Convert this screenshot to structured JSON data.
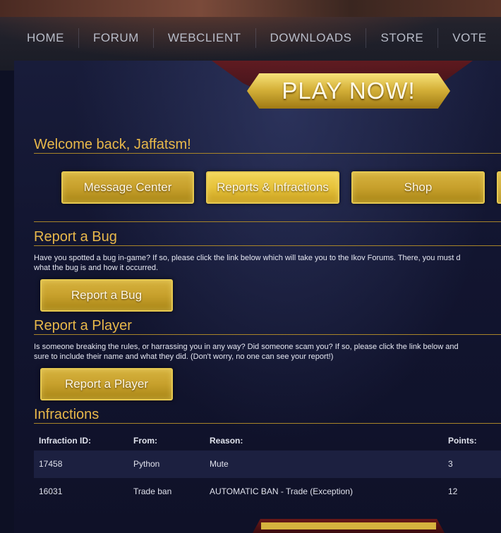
{
  "nav": {
    "items": [
      "HOME",
      "FORUM",
      "WEBCLIENT",
      "DOWNLOADS",
      "STORE",
      "VOTE"
    ]
  },
  "play_button": {
    "label": "PLAY NOW!"
  },
  "welcome": {
    "title": "Welcome back, Jaffatsm!"
  },
  "account_tabs": [
    "Message Center",
    "Reports & Infractions",
    "Shop"
  ],
  "report_bug": {
    "title": "Report a Bug",
    "text_line1": "Have you spotted a bug in-game? If so, please click the link below which will take you to the Ikov Forums. There, you must d",
    "text_line2": "what the bug is and how it occurred.",
    "button": "Report a Bug"
  },
  "report_player": {
    "title": "Report a Player",
    "text_line1": "Is someone breaking the rules, or harrassing you in any way? Did someone scam you? If so, please click the link below and",
    "text_line2": "sure to include their name and what they did. (Don't worry, no one can see your report!)",
    "button": "Report a Player"
  },
  "infractions": {
    "title": "Infractions",
    "headers": [
      "Infraction ID:",
      "From:",
      "Reason:",
      "Points:"
    ],
    "rows": [
      [
        "17458",
        "Python",
        "Mute",
        "3"
      ],
      [
        "16031",
        "Trade ban",
        "AUTOMATIC BAN - Trade (Exception)",
        "12"
      ]
    ]
  },
  "colors": {
    "accent_gold": "#e8b84a",
    "background": "#0d1024"
  }
}
